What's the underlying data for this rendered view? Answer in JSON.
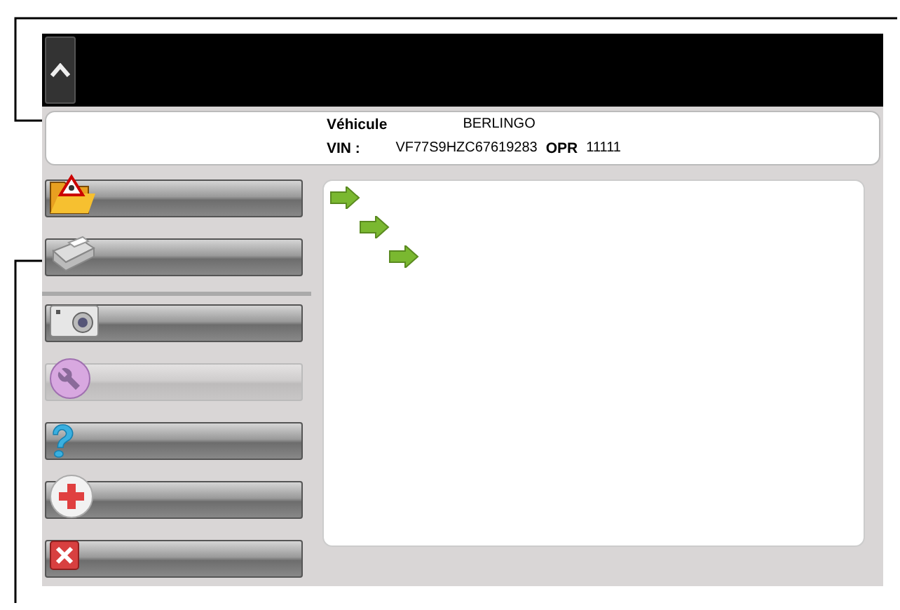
{
  "vehicle_info": {
    "vehicle_label": "Véhicule",
    "vehicle_value": "BERLINGO",
    "vin_label": "VIN :",
    "vin_value": "VF77S9HZC67619283",
    "opr_label": "OPR",
    "opr_value": "11111"
  },
  "menu_groups": [
    {
      "items": [
        {
          "kind": "warning-folder",
          "disabled": false
        },
        {
          "kind": "printer",
          "disabled": false
        }
      ]
    },
    {
      "items": [
        {
          "kind": "camera",
          "disabled": false
        },
        {
          "kind": "wrench",
          "disabled": true
        },
        {
          "kind": "help",
          "disabled": false
        },
        {
          "kind": "first-aid",
          "disabled": false
        },
        {
          "kind": "close",
          "disabled": false
        }
      ]
    }
  ]
}
